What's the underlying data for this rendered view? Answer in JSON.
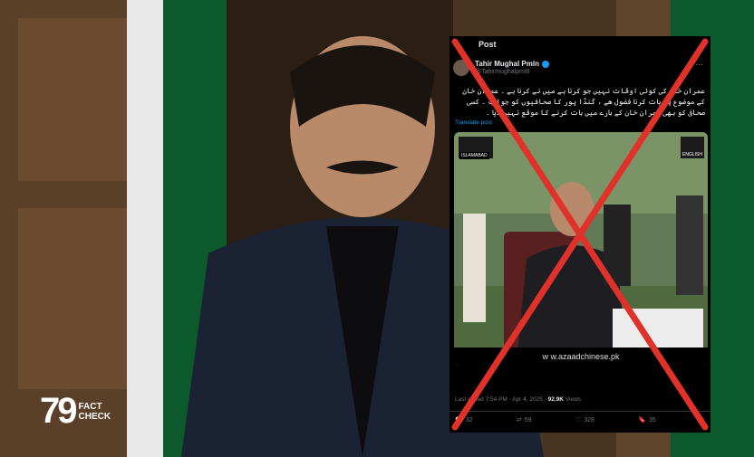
{
  "post": {
    "header_title": "Post",
    "author_name": "Tahir Mughal Pmln",
    "author_handle": "@Tahirmughalpml8",
    "body_urdu": "عمران خان کی کوئی اوقات نہیں جو کرنا ہے میں نے کرنا ہے ۔ عمران خان کے موضوع پر بات کرنا فضول ھے ، گنڈا پور کا صحافیوں کو جواب ۔ کسی صحافی کو بھی عمران خان کے بارے میں بات کرنے کا موقع نہیں دیا ۔",
    "translate_label": "Translate post",
    "media_watermark": "w w.azaadchinese.pk",
    "media_tag_left": "ISLAMABAD",
    "media_tag_right": "ENGLISH",
    "timestamp": "Last edited 7:54 PM · Apr 4, 2025 ·",
    "views_count": "92.9K",
    "views_label": "Views",
    "replies": "32",
    "reposts": "59",
    "likes": "328",
    "bookmarks": "35"
  },
  "branding": {
    "logo_number": "79",
    "logo_text_1": "FACT",
    "logo_text_2": "CHECK"
  },
  "colors": {
    "cross": "#e0312b",
    "verified": "#1d9bf0",
    "flag_green": "#0c5a2c"
  }
}
